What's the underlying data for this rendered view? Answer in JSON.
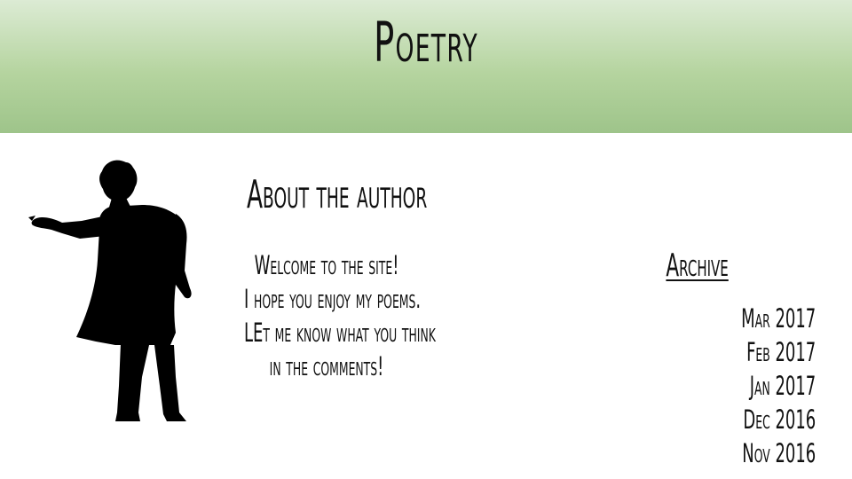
{
  "header": {
    "title": "Poetry",
    "background_top": "#dcebd4",
    "background_bottom": "#9ec48a"
  },
  "about": {
    "heading": "About the author",
    "lines": [
      "Welcome to the site!",
      "I hope you enjoy my poems.",
      "LEt me know what you think",
      "in the comments!"
    ]
  },
  "author_image": {
    "icon": "author-silhouette-icon"
  },
  "archive": {
    "heading": "Archive",
    "items": [
      {
        "label": "Mar 2017"
      },
      {
        "label": "Feb 2017"
      },
      {
        "label": "Jan 2017"
      },
      {
        "label": "Dec 2016"
      },
      {
        "label": "Nov 2016"
      }
    ]
  }
}
